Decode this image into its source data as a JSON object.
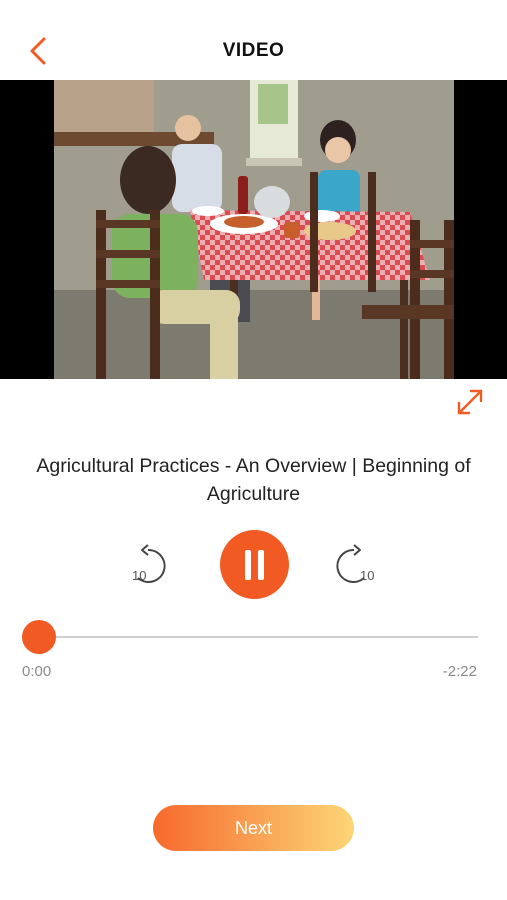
{
  "header": {
    "title": "VIDEO",
    "back_icon": "chevron-left-icon"
  },
  "video": {
    "scene": "family-dinner-scene",
    "fullscreen_icon": "expand-icon"
  },
  "media": {
    "title": "Agricultural Practices - An Overview | Beginning of Agriculture",
    "rewind_seconds": "10",
    "forward_seconds": "10",
    "rewind_icon": "rewind-10-icon",
    "forward_icon": "forward-10-icon",
    "play_state_icon": "pause-icon"
  },
  "progress": {
    "current": "0:00",
    "remaining": "-2:22",
    "fraction": 0.0
  },
  "footer": {
    "next_label": "Next"
  },
  "colors": {
    "accent": "#f25a24",
    "gradient_start": "#f7692d",
    "gradient_end": "#fcd677"
  }
}
